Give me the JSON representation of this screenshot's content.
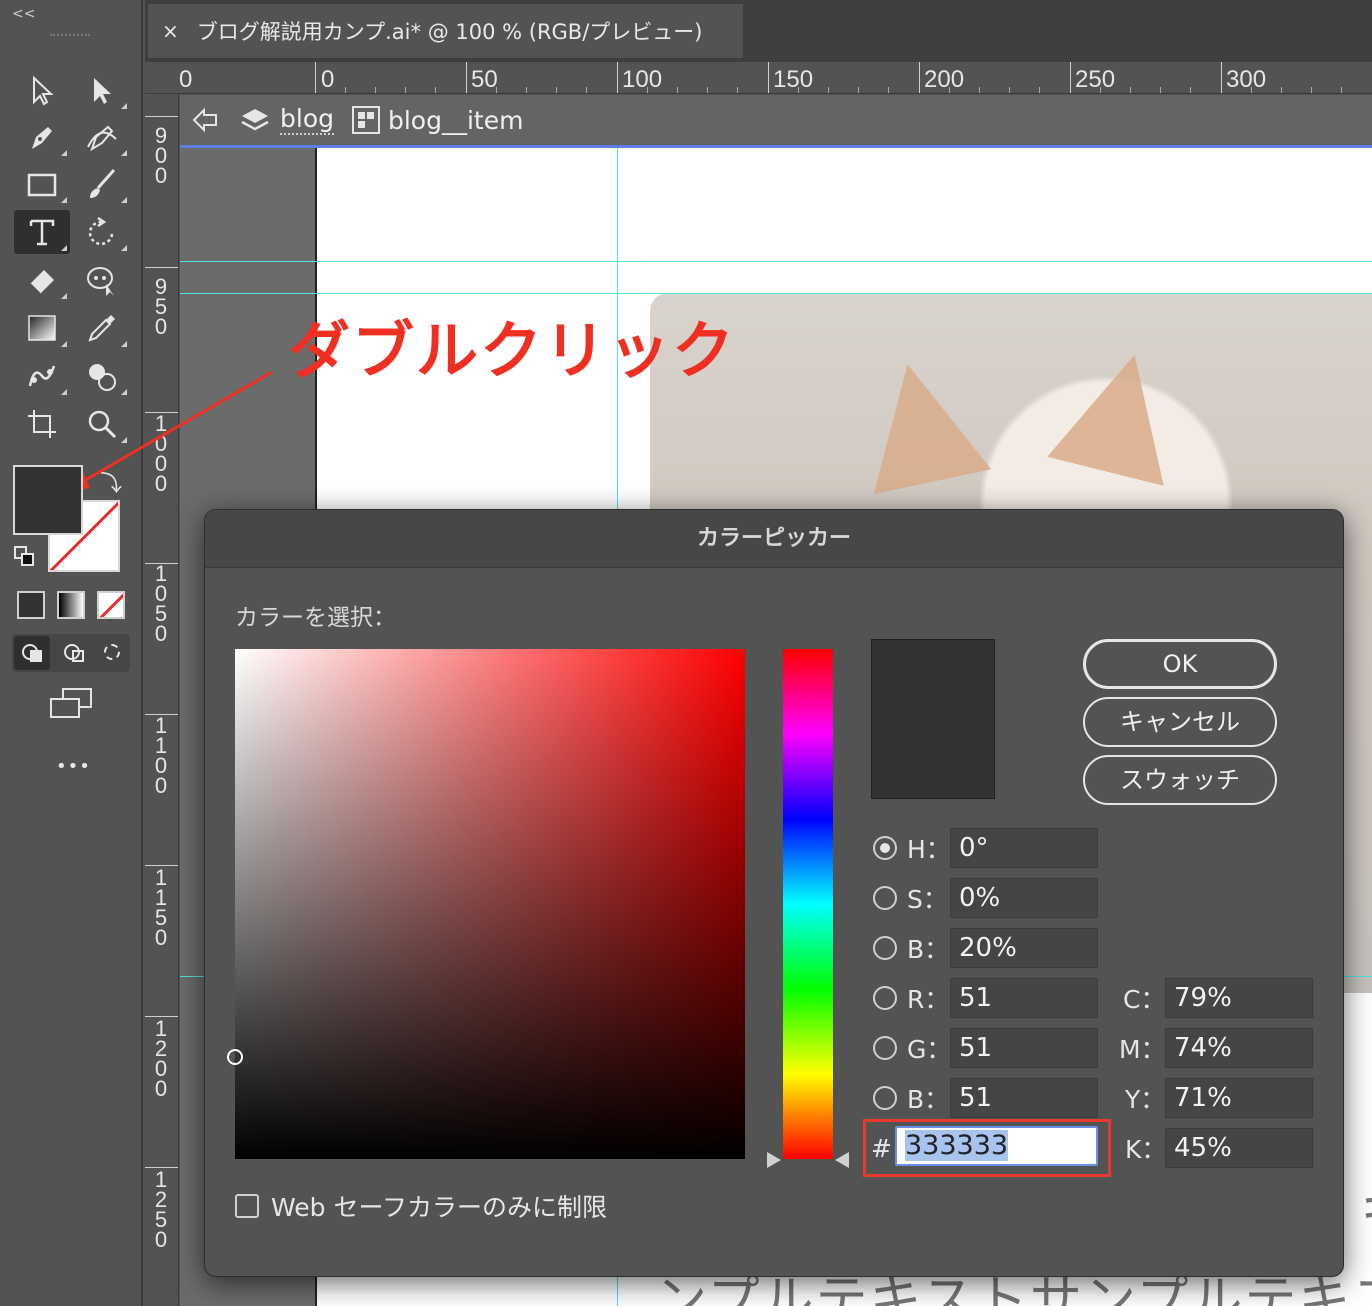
{
  "document_tab": {
    "close_symbol": "×",
    "title": "ブログ解説用カンプ.ai* @ 100 % (RGB/プレビュー)"
  },
  "toolbar": {
    "collapse_symbol": "<<",
    "more_symbol": "•••",
    "tools": [
      "selection-tool",
      "direct-selection-tool",
      "pen-tool",
      "curvature-tool",
      "rectangle-tool",
      "paintbrush-tool",
      "type-tool",
      "rotate-tool",
      "eraser-tool",
      "puppet-warp-tool",
      "gradient-tool",
      "eyedropper-tool",
      "blend-tool",
      "shape-builder-tool",
      "artboard-tool",
      "zoom-tool"
    ],
    "fill_color": "#333333"
  },
  "ruler": {
    "horizontal": [
      "0",
      "0",
      "50",
      "100",
      "150",
      "200",
      "250",
      "300"
    ],
    "vertical": [
      "900",
      "950",
      "1000",
      "1050",
      "1100",
      "1150",
      "1200",
      "1250"
    ]
  },
  "isolation_bar": {
    "crumb1": "blog",
    "crumb2": "blog__item"
  },
  "annotation": {
    "text": "ダブルクリック",
    "color": "#ee2f22"
  },
  "canvas": {
    "sample_text": "ンプルテキストサンプルテキス",
    "sample_text_edge": "キ"
  },
  "color_picker": {
    "title": "カラーピッカー",
    "select_label": "カラーを選択：",
    "buttons": {
      "ok": "OK",
      "cancel": "キャンセル",
      "swatches": "スウォッチ"
    },
    "hsb": [
      {
        "label": "H：",
        "value": "0°",
        "selected": true
      },
      {
        "label": "S：",
        "value": "0%",
        "selected": false
      },
      {
        "label": "B：",
        "value": "20%",
        "selected": false
      }
    ],
    "rgb": [
      {
        "label": "R：",
        "value": "51"
      },
      {
        "label": "G：",
        "value": "51"
      },
      {
        "label": "B：",
        "value": "51"
      }
    ],
    "cmyk": [
      {
        "label": "C：",
        "value": "79%"
      },
      {
        "label": "M：",
        "value": "74%"
      },
      {
        "label": "Y：",
        "value": "71%"
      },
      {
        "label": "K：",
        "value": "45%"
      }
    ],
    "hex_label": "#",
    "hex_value": "333333",
    "web_safe_label": "Web セーフカラーのみに制限",
    "current_color": "#333333",
    "saturation": 0.0,
    "brightness": 0.2,
    "hue": 0
  }
}
